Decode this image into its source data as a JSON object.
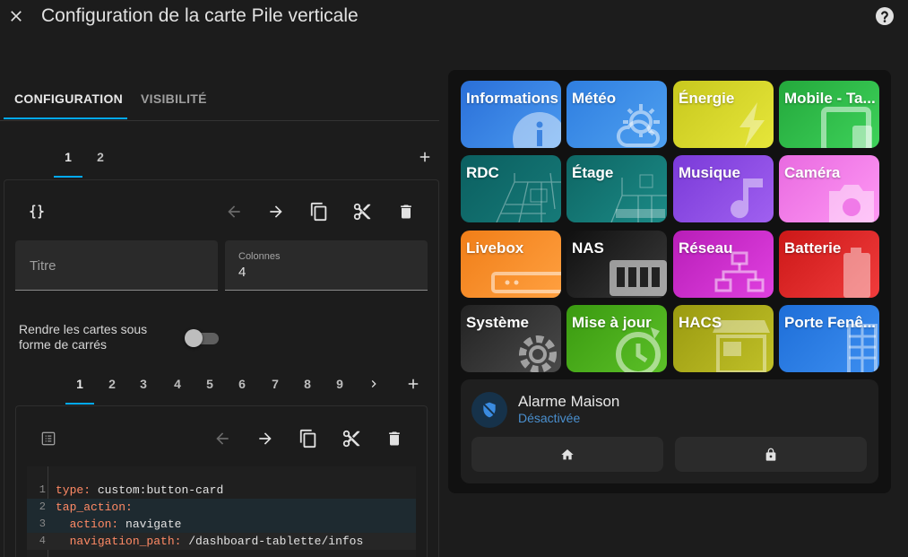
{
  "dialog": {
    "title": "Configuration de la carte Pile verticale"
  },
  "tabs": [
    {
      "label": "CONFIGURATION"
    },
    {
      "label": "VISIBILITÉ"
    }
  ],
  "card_tabs": [
    "1",
    "2"
  ],
  "field_titre": {
    "placeholder": "Titre"
  },
  "field_colonnes": {
    "label": "Colonnes",
    "value": "4"
  },
  "toggle_square": {
    "label": "Rendre les cartes sous forme de carrés",
    "state": "off"
  },
  "sub_tabs": [
    "1",
    "2",
    "3",
    "4",
    "5",
    "6",
    "7",
    "8",
    "9"
  ],
  "code": [
    {
      "n": "1",
      "key": "type",
      "val": " custom:button-card",
      "indent": ""
    },
    {
      "n": "2",
      "key": "tap_action",
      "val": "",
      "indent": ""
    },
    {
      "n": "3",
      "key": "action",
      "val": " navigate",
      "indent": "  "
    },
    {
      "n": "4",
      "key": "navigation_path",
      "val": " /dashboard-tablette/infos",
      "indent": "  "
    }
  ],
  "tiles": [
    {
      "label": "Informations",
      "color": "#2f7fe0"
    },
    {
      "label": "Météo",
      "color": "#3d8ce8"
    },
    {
      "label": "Énergie",
      "color": "#d4d42a"
    },
    {
      "label": "Mobile - Ta...",
      "color": "#2fb84a"
    },
    {
      "label": "RDC",
      "color": "#0d6e6e"
    },
    {
      "label": "Étage",
      "color": "#117a78"
    },
    {
      "label": "Musique",
      "color": "#8a45e0"
    },
    {
      "label": "Caméra",
      "color": "#f07ae8"
    },
    {
      "label": "Livebox",
      "color": "#f08a24"
    },
    {
      "label": "NAS",
      "color": "#1e1e1e"
    },
    {
      "label": "Réseau",
      "color": "#c926c9"
    },
    {
      "label": "Batterie",
      "color": "#d82424"
    },
    {
      "label": "Système",
      "color": "#303030"
    },
    {
      "label": "Mise à jour",
      "color": "#46a818"
    },
    {
      "label": "HACS",
      "color": "#a8a812"
    },
    {
      "label": "Porte Fenê...",
      "color": "#2a7be0"
    }
  ],
  "alarm": {
    "name": "Alarme Maison",
    "state": "Désactivée"
  }
}
